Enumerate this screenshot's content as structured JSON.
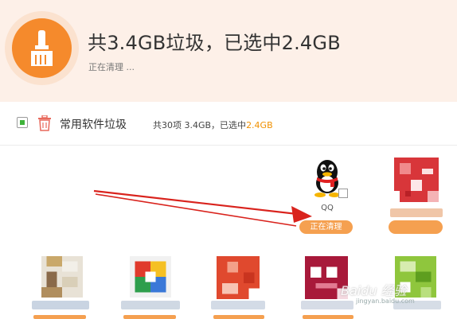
{
  "header": {
    "title": "共3.4GB垃圾，已选中2.4GB",
    "status": "正在清理 ..."
  },
  "category": {
    "name": "常用软件垃圾",
    "summary_prefix": "共30项 3.4GB，已选中",
    "summary_selected": "2.4GB",
    "checked": true
  },
  "apps": [
    {
      "name": "QQ",
      "icon": "qq-penguin-icon",
      "action_label": "正在清理"
    }
  ],
  "watermark": {
    "text": "Baidu 经验",
    "sub": "jingyan.baidu.com"
  },
  "colors": {
    "accent": "#f58a2c",
    "highlight": "#f09000",
    "check": "#3fb33a",
    "annotation_arrow": "#d9231d"
  }
}
